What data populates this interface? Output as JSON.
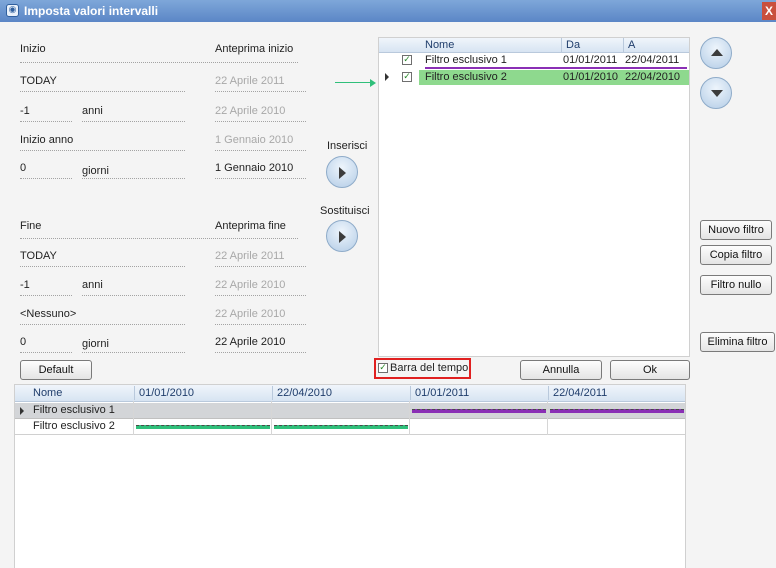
{
  "window": {
    "title": "Imposta valori intervalli",
    "close_glyph": "X"
  },
  "inizio": {
    "label": "Inizio",
    "preview_label": "Anteprima inizio",
    "row1_value": "TODAY",
    "row1_preview": "22 Aprile 2011",
    "row2_value": "-1",
    "row2_unit": "anni",
    "row2_preview": "22 Aprile 2010",
    "row3_value": "Inizio anno",
    "row3_preview": "1 Gennaio 2010",
    "row4_value": "0",
    "row4_unit": "giorni",
    "row4_preview": "1 Gennaio 2010"
  },
  "fine": {
    "label": "Fine",
    "preview_label": "Anteprima fine",
    "row1_value": "TODAY",
    "row1_preview": "22 Aprile 2011",
    "row2_value": "-1",
    "row2_unit": "anni",
    "row2_preview": "22 Aprile 2010",
    "row3_value": "<Nessuno>",
    "row3_preview": "22 Aprile 2010",
    "row4_value": "0",
    "row4_unit": "giorni",
    "row4_preview": "22 Aprile 2010"
  },
  "actions": {
    "inserisci": "Inserisci",
    "sostituisci": "Sostituisci"
  },
  "filter_grid": {
    "headers": {
      "nome": "Nome",
      "da": "Da",
      "a": "A"
    },
    "rows": [
      {
        "nome": "Filtro esclusivo 1",
        "da": "01/01/2011",
        "a": "22/04/2011",
        "checked": true
      },
      {
        "nome": "Filtro esclusivo 2",
        "da": "01/01/2010",
        "a": "22/04/2010",
        "checked": true
      }
    ],
    "check_glyph": "✓"
  },
  "side_buttons": {
    "nuovo": "Nuovo filtro",
    "copia": "Copia filtro",
    "nullo": "Filtro nullo",
    "elimina": "Elimina filtro"
  },
  "bottom_buttons": {
    "default": "Default",
    "barra": "Barra del tempo",
    "annulla": "Annulla",
    "ok": "Ok"
  },
  "timeline": {
    "headers": {
      "nome": "Nome",
      "d1": "01/01/2010",
      "d2": "22/04/2010",
      "d3": "01/01/2011",
      "d4": "22/04/2011"
    },
    "rows": [
      {
        "nome": "Filtro esclusivo 1"
      },
      {
        "nome": "Filtro esclusivo 2"
      }
    ]
  },
  "colors": {
    "selected_row": "#8ed98e",
    "purple_bar": "#8a2fb5",
    "green_bar": "#2fbf7a",
    "arrow": "#2fbf7a"
  }
}
